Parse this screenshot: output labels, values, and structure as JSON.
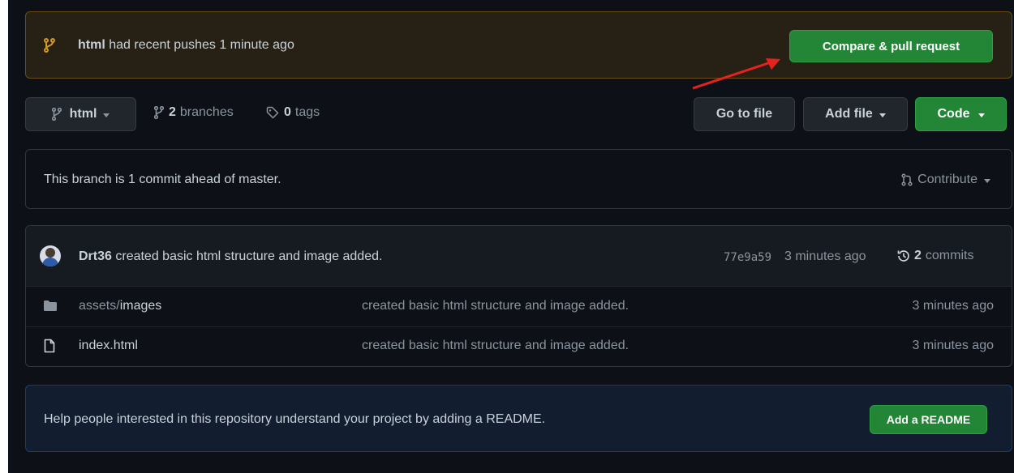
{
  "banner": {
    "branch": "html",
    "message": "had recent pushes 1 minute ago",
    "compare_button": "Compare & pull request"
  },
  "toolbar": {
    "branch_select": "html",
    "branches_count": "2",
    "branches_label": "branches",
    "tags_count": "0",
    "tags_label": "tags",
    "go_to_file": "Go to file",
    "add_file": "Add file",
    "code": "Code"
  },
  "ahead_notice": {
    "text": "This branch is 1 commit ahead of master.",
    "contribute": "Contribute"
  },
  "commit_header": {
    "author": "Drt36",
    "message": "created basic html structure and image added.",
    "sha": "77e9a59",
    "time": "3 minutes ago",
    "commits_count": "2",
    "commits_label": "commits"
  },
  "files": [
    {
      "type": "folder",
      "name_prefix": "assets/",
      "name": "images",
      "message": "created basic html structure and image added.",
      "time": "3 minutes ago"
    },
    {
      "type": "file",
      "name_prefix": "",
      "name": "index.html",
      "message": "created basic html structure and image added.",
      "time": "3 minutes ago"
    }
  ],
  "readme_prompt": {
    "text": "Help people interested in this repository understand your project by adding a README.",
    "button": "Add a README"
  },
  "colors": {
    "accent_green": "#238636",
    "bg": "#0d1117",
    "banner_bg": "#272115",
    "annotation_red": "#e5231d"
  }
}
